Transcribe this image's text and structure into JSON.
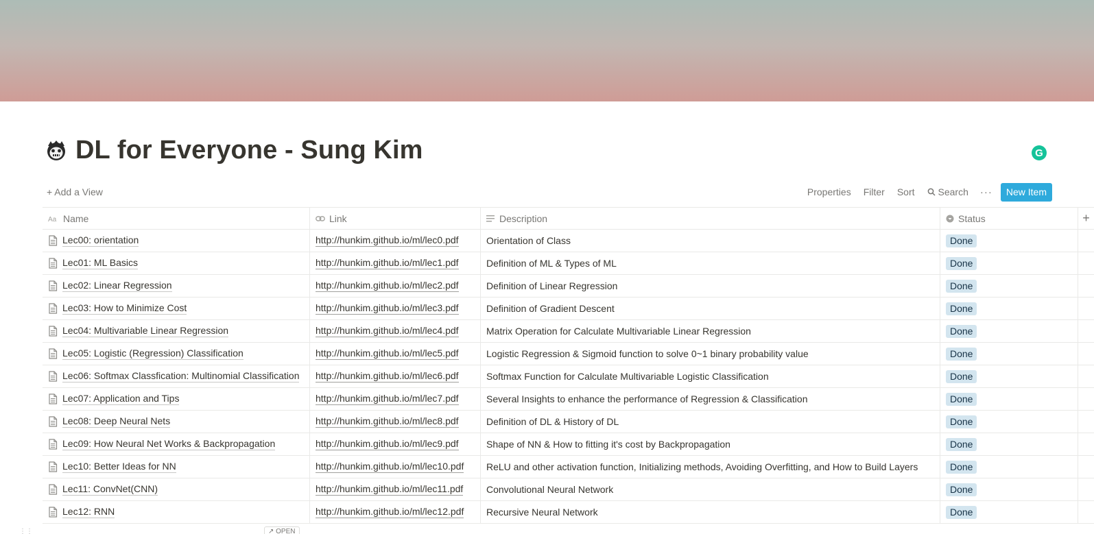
{
  "page": {
    "title": "DL for Everyone - Sung Kim",
    "icon": "mascot-avatar-icon"
  },
  "extensions": {
    "grammarly_letter": "G"
  },
  "toolbar": {
    "add_view": "+ Add a View",
    "properties": "Properties",
    "filter": "Filter",
    "sort": "Sort",
    "search": "Search",
    "more": "···",
    "new_item": "New Item"
  },
  "table": {
    "columns": {
      "name": "Name",
      "link": "Link",
      "description": "Description",
      "status": "Status",
      "add": "+"
    },
    "rows": [
      {
        "name": "Lec00: orientation",
        "link": "http://hunkim.github.io/ml/lec0.pdf",
        "description": "Orientation of Class",
        "status": "Done"
      },
      {
        "name": "Lec01: ML Basics",
        "link": "http://hunkim.github.io/ml/lec1.pdf",
        "description": "Definition of ML & Types of ML",
        "status": "Done"
      },
      {
        "name": "Lec02: Linear Regression",
        "link": "http://hunkim.github.io/ml/lec2.pdf",
        "description": "Definition of Linear Regression",
        "status": "Done"
      },
      {
        "name": "Lec03: How to Minimize Cost",
        "link": "http://hunkim.github.io/ml/lec3.pdf",
        "description": "Definition of Gradient Descent",
        "status": "Done"
      },
      {
        "name": "Lec04: Multivariable Linear Regression",
        "link": "http://hunkim.github.io/ml/lec4.pdf",
        "description": "Matrix Operation for Calculate Multivariable Linear Regression",
        "status": "Done"
      },
      {
        "name": "Lec05: Logistic (Regression) Classification",
        "link": "http://hunkim.github.io/ml/lec5.pdf",
        "description": "Logistic Regression & Sigmoid function to solve 0~1 binary probability value",
        "status": "Done"
      },
      {
        "name": "Lec06: Softmax Classfication: Multinomial Classification",
        "link": "http://hunkim.github.io/ml/lec6.pdf",
        "description": "Softmax Function for Calculate Multivariable Logistic Classification",
        "status": "Done"
      },
      {
        "name": "Lec07: Application and Tips",
        "link": "http://hunkim.github.io/ml/lec7.pdf",
        "description": "Several Insights to enhance the performance of Regression & Classification",
        "status": "Done"
      },
      {
        "name": "Lec08: Deep Neural Nets",
        "link": "http://hunkim.github.io/ml/lec8.pdf",
        "description": "Definition of DL & History of DL",
        "status": "Done"
      },
      {
        "name": "Lec09: How Neural Net Works & Backpropagation",
        "link": "http://hunkim.github.io/ml/lec9.pdf",
        "description": "Shape of NN & How to fitting it's cost by Backpropagation",
        "status": "Done"
      },
      {
        "name": "Lec10: Better Ideas for NN",
        "link": "http://hunkim.github.io/ml/lec10.pdf",
        "description": "ReLU and other activation function, Initializing methods, Avoiding Overfitting, and How to Build Layers",
        "status": "Done"
      },
      {
        "name": "Lec11: ConvNet(CNN)",
        "link": "http://hunkim.github.io/ml/lec11.pdf",
        "description": "Convolutional Neural Network",
        "status": "Done"
      },
      {
        "name": "Lec12: RNN",
        "link": "http://hunkim.github.io/ml/lec12.pdf",
        "description": "Recursive Neural Network",
        "status": "Done"
      }
    ],
    "open_chip": "↗ OPEN"
  },
  "colors": {
    "accent": "#2eaadc",
    "status_done_bg": "#d3e5ef",
    "grammarly": "#15c39a"
  }
}
